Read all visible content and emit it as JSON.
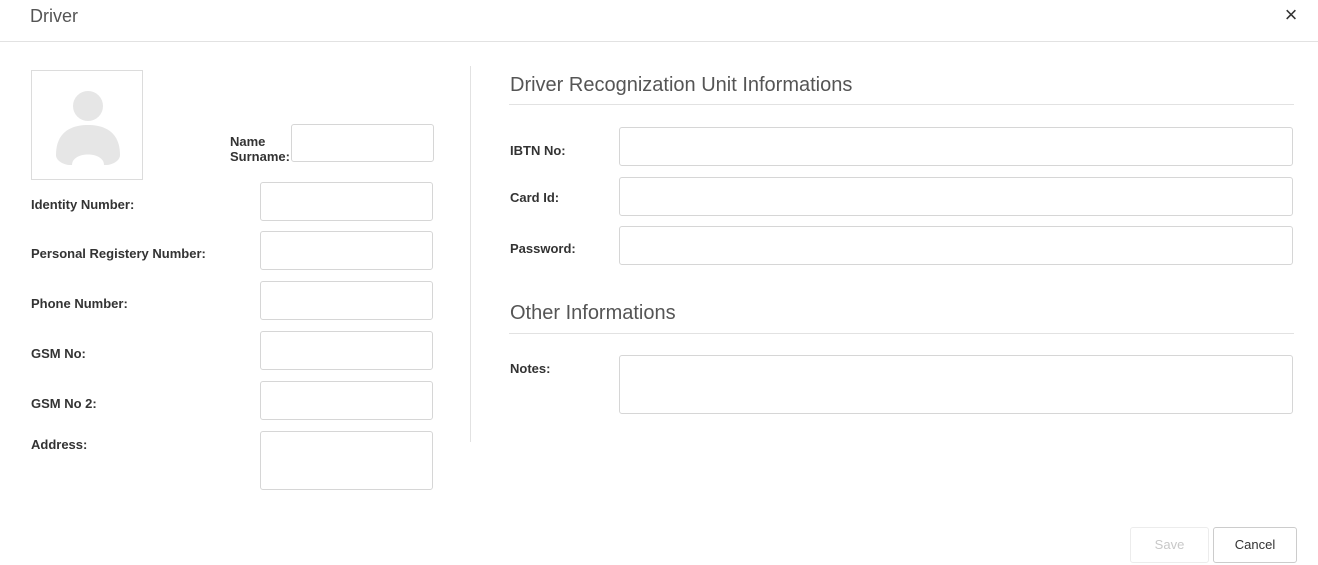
{
  "dialog": {
    "title": "Driver",
    "close_symbol": "×"
  },
  "avatar": {
    "icon": "user-placeholder-icon"
  },
  "personal": {
    "name_label_line1": "Name",
    "name_label_line2": "Surname:",
    "identity_label": "Identity Number:",
    "registry_label": "Personal Registery Number:",
    "phone_label": "Phone Number:",
    "gsm_label": "GSM No:",
    "gsm2_label": "GSM No 2:",
    "address_label": "Address:",
    "values": {
      "name": "",
      "identity": "",
      "registry": "",
      "phone": "",
      "gsm": "",
      "gsm2": "",
      "address": ""
    }
  },
  "recognition": {
    "title": "Driver Recognization Unit Informations",
    "ibtn_label": "IBTN No:",
    "card_label": "Card Id:",
    "password_label": "Password:",
    "values": {
      "ibtn": "",
      "card": "",
      "password": ""
    }
  },
  "other": {
    "title": "Other Informations",
    "notes_label": "Notes:",
    "values": {
      "notes": ""
    }
  },
  "footer": {
    "save_label": "Save",
    "cancel_label": "Cancel"
  }
}
